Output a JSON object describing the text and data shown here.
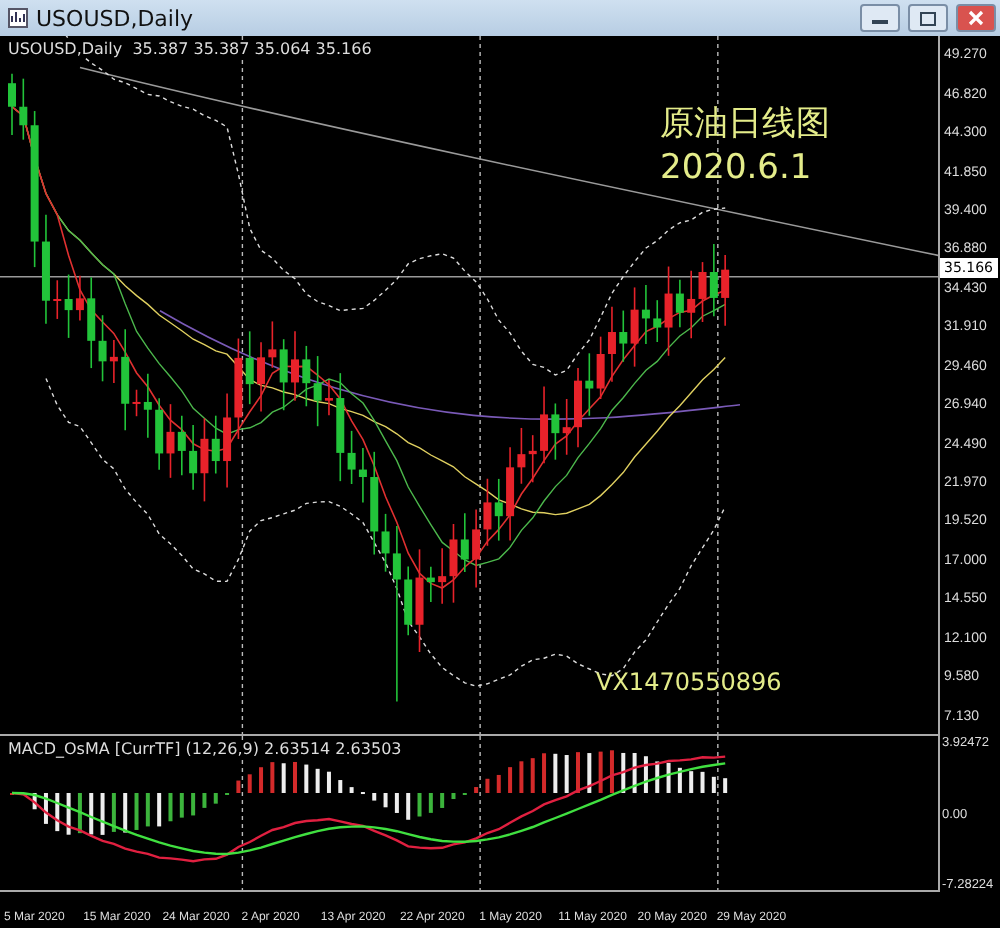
{
  "window": {
    "title": "USOUSD,Daily"
  },
  "chart": {
    "header": "USOUSD,Daily  35.387 35.387 35.064 35.166",
    "overlay_title": "原油日线图",
    "overlay_date": "2020.6.1",
    "contact_text": "VX1470550896",
    "price_labels": [
      "49.270",
      "46.820",
      "44.300",
      "41.850",
      "39.400",
      "36.880",
      "34.430",
      "31.910",
      "29.460",
      "26.940",
      "24.490",
      "21.970",
      "19.520",
      "17.000",
      "14.550",
      "12.100",
      "9.580",
      "7.130"
    ],
    "current_price": "35.166"
  },
  "macd": {
    "header": "MACD_OsMA [CurrTF] (12,26,9) 2.63514 2.63503",
    "scale_labels": [
      "3.92472",
      "0.00",
      "-7.28224"
    ]
  },
  "date_labels": [
    "5 Mar 2020",
    "15 Mar 2020",
    "24 Mar 2020",
    "2 Apr 2020",
    "13 Apr 2020",
    "22 Apr 2020",
    "1 May 2020",
    "11 May 2020",
    "20 May 2020",
    "29 May 2020"
  ]
}
